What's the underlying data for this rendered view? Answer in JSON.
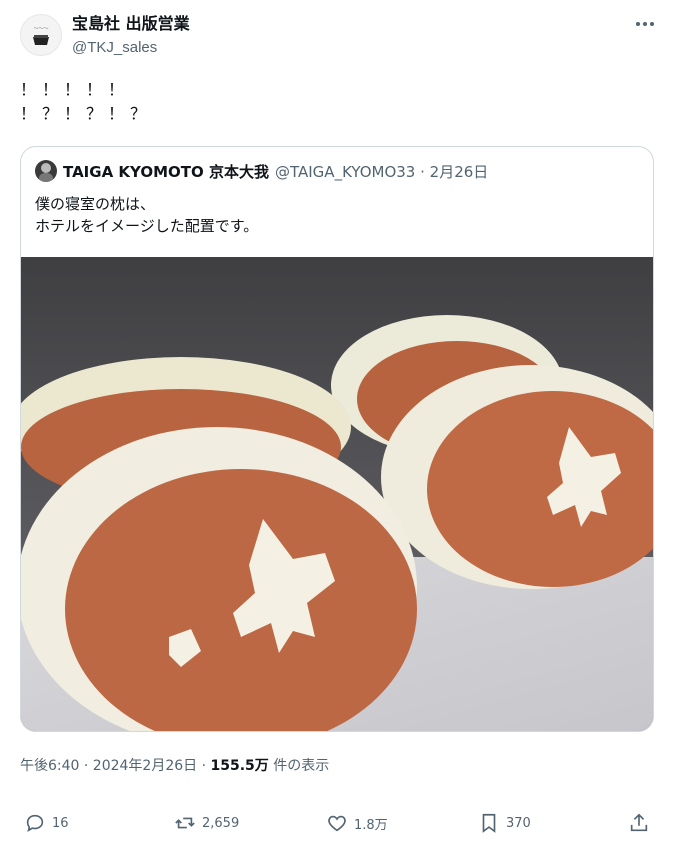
{
  "author": {
    "name": "宝島社 出版営業",
    "handle": "@TKJ_sales"
  },
  "tweet": {
    "line1": "！！！！！",
    "line2": "！？！？！？"
  },
  "quote": {
    "name": "TAIGA KYOMOTO 京本大我",
    "handle_date": "@TAIGA_KYOMO33 · 2月26日",
    "body_line1": "僕の寝室の枕は、",
    "body_line2": "ホテルをイメージした配置です。"
  },
  "meta": {
    "time_date": "午後6:40 · 2024年2月26日 · ",
    "views": "155.5万",
    "views_suffix": " 件の表示"
  },
  "actions": {
    "replies": "16",
    "reposts": "2,659",
    "likes": "1.8万",
    "bookmarks": "370"
  },
  "icons": [
    "more-icon",
    "reply-icon",
    "repost-icon",
    "like-icon",
    "bookmark-icon",
    "share-icon"
  ]
}
